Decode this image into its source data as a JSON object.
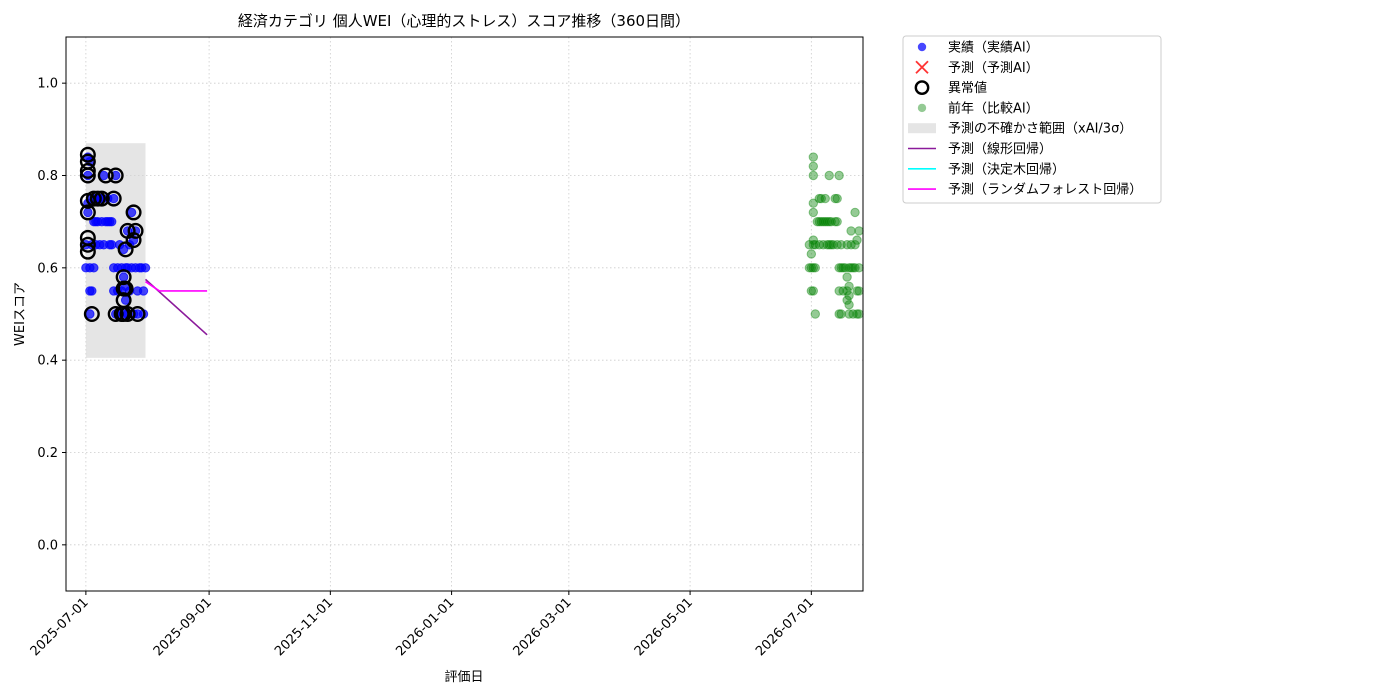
{
  "chart_data": {
    "type": "scatter",
    "title": "経済カテゴリ 個人WEI（心理的ストレス）スコア推移（360日間）",
    "xlabel": "評価日",
    "ylabel": "WEIスコア",
    "xlim": [
      "2025-06-21",
      "2026-07-27"
    ],
    "ylim": [
      -0.1,
      1.1
    ],
    "x_ticks": [
      "2025-07-01",
      "2025-09-01",
      "2025-11-01",
      "2026-01-01",
      "2026-03-01",
      "2026-05-01",
      "2026-07-01"
    ],
    "y_ticks": [
      0.0,
      0.2,
      0.4,
      0.6,
      0.8,
      1.0
    ],
    "y_tick_labels": [
      "0.0",
      "0.2",
      "0.4",
      "0.6",
      "0.8",
      "1.0"
    ],
    "grid": true,
    "legend_position": "outside-top-right",
    "colors": {
      "actual": "#0000ff",
      "predicted": "#ff0000",
      "anomaly_edge": "#000000",
      "previous_year": "#008000",
      "uncertainty": "#d3d3d3",
      "linear": "#8b1a9b",
      "tree": "#00ffff",
      "forest": "#ff00ff"
    },
    "legend": [
      {
        "key": "actual",
        "label": "実績（実績AI）",
        "marker": "dot"
      },
      {
        "key": "predicted",
        "label": "予測（予測AI）",
        "marker": "x"
      },
      {
        "key": "anomaly",
        "label": "異常値",
        "marker": "ring"
      },
      {
        "key": "previous_year",
        "label": "前年（比較AI）",
        "marker": "dot-faint"
      },
      {
        "key": "uncertainty",
        "label": "予測の不確かさ範囲（xAI/3σ）",
        "marker": "band"
      },
      {
        "key": "linear",
        "label": "予測（線形回帰）",
        "marker": "line"
      },
      {
        "key": "tree",
        "label": "予測（決定木回帰）",
        "marker": "line"
      },
      {
        "key": "forest",
        "label": "予測（ランダムフォレスト回帰）",
        "marker": "line"
      }
    ],
    "uncertainty_band": {
      "x": [
        "2025-07-01",
        "2025-07-31"
      ],
      "y": [
        0.405,
        0.87
      ]
    },
    "series": [
      {
        "key": "actual",
        "points": [
          [
            "2025-07-01",
            0.65
          ],
          [
            "2025-07-01",
            0.6
          ],
          [
            "2025-07-02",
            0.8
          ],
          [
            "2025-07-02",
            0.84
          ],
          [
            "2025-07-02",
            0.74
          ],
          [
            "2025-07-02",
            0.72
          ],
          [
            "2025-07-03",
            0.55
          ],
          [
            "2025-07-03",
            0.5
          ],
          [
            "2025-07-03",
            0.6
          ],
          [
            "2025-07-03",
            0.83
          ],
          [
            "2025-07-04",
            0.75
          ],
          [
            "2025-07-04",
            0.65
          ],
          [
            "2025-07-04",
            0.55
          ],
          [
            "2025-07-05",
            0.7
          ],
          [
            "2025-07-05",
            0.6
          ],
          [
            "2025-07-06",
            0.75
          ],
          [
            "2025-07-06",
            0.7
          ],
          [
            "2025-07-06",
            0.65
          ],
          [
            "2025-07-07",
            0.75
          ],
          [
            "2025-07-07",
            0.7
          ],
          [
            "2025-07-08",
            0.75
          ],
          [
            "2025-07-08",
            0.65
          ],
          [
            "2025-07-09",
            0.75
          ],
          [
            "2025-07-09",
            0.7
          ],
          [
            "2025-07-10",
            0.8
          ],
          [
            "2025-07-10",
            0.65
          ],
          [
            "2025-07-11",
            0.7
          ],
          [
            "2025-07-12",
            0.75
          ],
          [
            "2025-07-12",
            0.7
          ],
          [
            "2025-07-13",
            0.65
          ],
          [
            "2025-07-13",
            0.7
          ],
          [
            "2025-07-14",
            0.7
          ],
          [
            "2025-07-14",
            0.65
          ],
          [
            "2025-07-15",
            0.75
          ],
          [
            "2025-07-15",
            0.6
          ],
          [
            "2025-07-15",
            0.55
          ],
          [
            "2025-07-16",
            0.8
          ],
          [
            "2025-07-16",
            0.5
          ],
          [
            "2025-07-17",
            0.6
          ],
          [
            "2025-07-17",
            0.55
          ],
          [
            "2025-07-18",
            0.65
          ],
          [
            "2025-07-18",
            0.5
          ],
          [
            "2025-07-19",
            0.6
          ],
          [
            "2025-07-19",
            0.55
          ],
          [
            "2025-07-20",
            0.64
          ],
          [
            "2025-07-20",
            0.58
          ],
          [
            "2025-07-20",
            0.5
          ],
          [
            "2025-07-21",
            0.56
          ],
          [
            "2025-07-21",
            0.53
          ],
          [
            "2025-07-21",
            0.6
          ],
          [
            "2025-07-22",
            0.68
          ],
          [
            "2025-07-22",
            0.6
          ],
          [
            "2025-07-22",
            0.5
          ],
          [
            "2025-07-23",
            0.65
          ],
          [
            "2025-07-23",
            0.55
          ],
          [
            "2025-07-24",
            0.72
          ],
          [
            "2025-07-24",
            0.6
          ],
          [
            "2025-07-25",
            0.66
          ],
          [
            "2025-07-25",
            0.5
          ],
          [
            "2025-07-26",
            0.68
          ],
          [
            "2025-07-26",
            0.6
          ],
          [
            "2025-07-27",
            0.55
          ],
          [
            "2025-07-27",
            0.5
          ],
          [
            "2025-07-28",
            0.6
          ],
          [
            "2025-07-29",
            0.6
          ],
          [
            "2025-07-30",
            0.55
          ],
          [
            "2025-07-30",
            0.5
          ],
          [
            "2025-07-31",
            0.6
          ]
        ]
      },
      {
        "key": "anomaly",
        "points": [
          [
            "2025-07-02",
            0.845
          ],
          [
            "2025-07-02",
            0.83
          ],
          [
            "2025-07-02",
            0.81
          ],
          [
            "2025-07-02",
            0.8
          ],
          [
            "2025-07-02",
            0.745
          ],
          [
            "2025-07-02",
            0.72
          ],
          [
            "2025-07-02",
            0.665
          ],
          [
            "2025-07-02",
            0.65
          ],
          [
            "2025-07-02",
            0.635
          ],
          [
            "2025-07-04",
            0.5
          ],
          [
            "2025-07-05",
            0.75
          ],
          [
            "2025-07-07",
            0.75
          ],
          [
            "2025-07-09",
            0.75
          ],
          [
            "2025-07-11",
            0.8
          ],
          [
            "2025-07-15",
            0.75
          ],
          [
            "2025-07-16",
            0.8
          ],
          [
            "2025-07-16",
            0.5
          ],
          [
            "2025-07-19",
            0.5
          ],
          [
            "2025-07-20",
            0.58
          ],
          [
            "2025-07-20",
            0.555
          ],
          [
            "2025-07-20",
            0.53
          ],
          [
            "2025-07-20",
            0.5
          ],
          [
            "2025-07-21",
            0.64
          ],
          [
            "2025-07-21",
            0.555
          ],
          [
            "2025-07-22",
            0.68
          ],
          [
            "2025-07-22",
            0.5
          ],
          [
            "2025-07-25",
            0.72
          ],
          [
            "2025-07-25",
            0.66
          ],
          [
            "2025-07-26",
            0.68
          ],
          [
            "2025-07-27",
            0.5
          ]
        ]
      },
      {
        "key": "previous_year",
        "points": [
          [
            "2026-06-30",
            0.65
          ],
          [
            "2026-06-30",
            0.6
          ],
          [
            "2026-07-01",
            0.6
          ],
          [
            "2026-07-01",
            0.55
          ],
          [
            "2026-07-01",
            0.63
          ],
          [
            "2026-07-02",
            0.84
          ],
          [
            "2026-07-02",
            0.8
          ],
          [
            "2026-07-02",
            0.74
          ],
          [
            "2026-07-02",
            0.72
          ],
          [
            "2026-07-02",
            0.66
          ],
          [
            "2026-07-02",
            0.65
          ],
          [
            "2026-07-02",
            0.6
          ],
          [
            "2026-07-02",
            0.55
          ],
          [
            "2026-07-02",
            0.82
          ],
          [
            "2026-07-03",
            0.5
          ],
          [
            "2026-07-03",
            0.65
          ],
          [
            "2026-07-03",
            0.6
          ],
          [
            "2026-07-04",
            0.7
          ],
          [
            "2026-07-05",
            0.75
          ],
          [
            "2026-07-05",
            0.7
          ],
          [
            "2026-07-05",
            0.65
          ],
          [
            "2026-07-06",
            0.75
          ],
          [
            "2026-07-06",
            0.7
          ],
          [
            "2026-07-07",
            0.7
          ],
          [
            "2026-07-07",
            0.65
          ],
          [
            "2026-07-08",
            0.75
          ],
          [
            "2026-07-08",
            0.7
          ],
          [
            "2026-07-09",
            0.7
          ],
          [
            "2026-07-09",
            0.65
          ],
          [
            "2026-07-10",
            0.8
          ],
          [
            "2026-07-10",
            0.7
          ],
          [
            "2026-07-10",
            0.65
          ],
          [
            "2026-07-11",
            0.7
          ],
          [
            "2026-07-11",
            0.65
          ],
          [
            "2026-07-12",
            0.65
          ],
          [
            "2026-07-13",
            0.75
          ],
          [
            "2026-07-13",
            0.7
          ],
          [
            "2026-07-14",
            0.75
          ],
          [
            "2026-07-14",
            0.7
          ],
          [
            "2026-07-14",
            0.65
          ],
          [
            "2026-07-15",
            0.8
          ],
          [
            "2026-07-15",
            0.6
          ],
          [
            "2026-07-15",
            0.5
          ],
          [
            "2026-07-15",
            0.55
          ],
          [
            "2026-07-16",
            0.65
          ],
          [
            "2026-07-16",
            0.6
          ],
          [
            "2026-07-16",
            0.5
          ],
          [
            "2026-07-17",
            0.6
          ],
          [
            "2026-07-17",
            0.55
          ],
          [
            "2026-07-18",
            0.6
          ],
          [
            "2026-07-19",
            0.58
          ],
          [
            "2026-07-19",
            0.55
          ],
          [
            "2026-07-19",
            0.53
          ],
          [
            "2026-07-19",
            0.65
          ],
          [
            "2026-07-20",
            0.6
          ],
          [
            "2026-07-20",
            0.56
          ],
          [
            "2026-07-20",
            0.52
          ],
          [
            "2026-07-20",
            0.5
          ],
          [
            "2026-07-20",
            0.54
          ],
          [
            "2026-07-21",
            0.68
          ],
          [
            "2026-07-21",
            0.65
          ],
          [
            "2026-07-21",
            0.6
          ],
          [
            "2026-07-22",
            0.6
          ],
          [
            "2026-07-22",
            0.5
          ],
          [
            "2026-07-23",
            0.72
          ],
          [
            "2026-07-23",
            0.65
          ],
          [
            "2026-07-23",
            0.6
          ],
          [
            "2026-07-24",
            0.66
          ],
          [
            "2026-07-24",
            0.55
          ],
          [
            "2026-07-24",
            0.5
          ],
          [
            "2026-07-25",
            0.68
          ],
          [
            "2026-07-25",
            0.6
          ],
          [
            "2026-07-25",
            0.55
          ],
          [
            "2026-07-25",
            0.5
          ]
        ]
      }
    ],
    "lines": [
      {
        "key": "linear",
        "points": [
          [
            "2025-07-31",
            0.575
          ],
          [
            "2025-08-31",
            0.455
          ]
        ]
      },
      {
        "key": "forest",
        "points": [
          [
            "2025-07-31",
            0.57
          ],
          [
            "2025-08-07",
            0.55
          ],
          [
            "2025-08-31",
            0.55
          ]
        ]
      }
    ]
  }
}
